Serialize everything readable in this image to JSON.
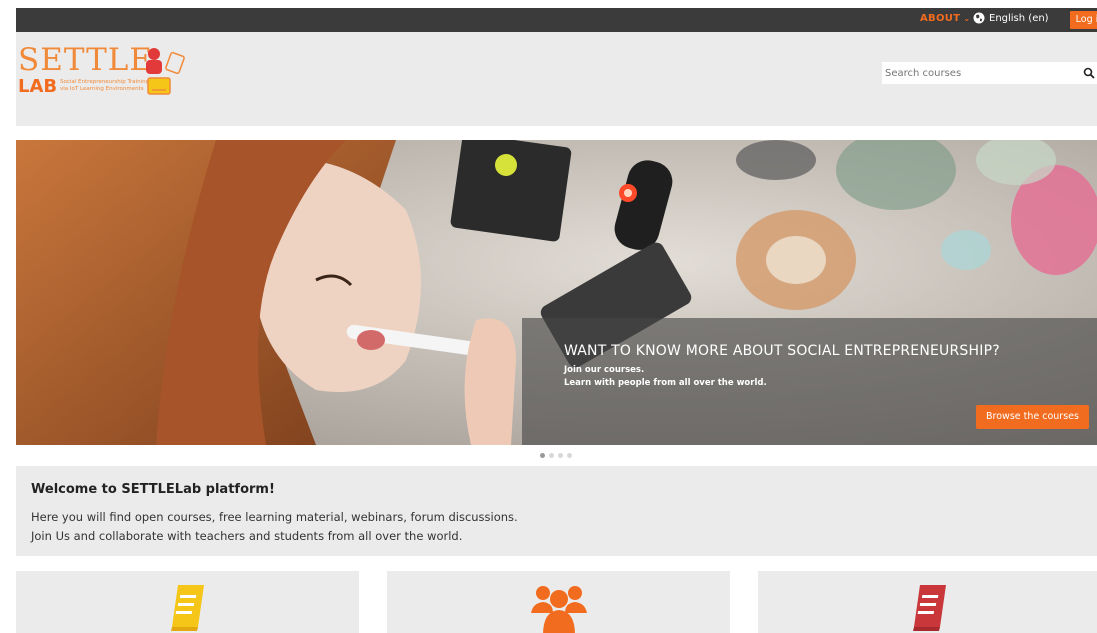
{
  "topbar": {
    "about_label": "ABOUT",
    "language_label": "English (en)",
    "login_label": "Log in"
  },
  "header": {
    "logo_title": "SETTLE",
    "logo_sub": "LAB",
    "logo_tagline_1": "Social Entrepreneurship Training",
    "logo_tagline_2": "via IoT Learning Environments",
    "search_placeholder": "Search courses"
  },
  "hero": {
    "heading": "WANT TO KNOW MORE ABOUT SOCIAL ENTREPRENEURSHIP?",
    "line1": "Join our courses.",
    "line2": "Learn with people from all over the world.",
    "button_label": "Browse the courses",
    "slide_count": 4,
    "active_slide": 1
  },
  "welcome": {
    "title": "Welcome to SETTLELab platform!",
    "line1": "Here you will find open courses, free learning material, webinars, forum discussions.",
    "line2": "Join Us and collaborate with teachers and students from all over the world."
  },
  "cards": [
    {
      "icon": "yellow-book-icon",
      "color": "#f5c518"
    },
    {
      "icon": "users-group-icon",
      "color": "#f26c1f"
    },
    {
      "icon": "red-book-icon",
      "color": "#c9373b"
    }
  ],
  "colors": {
    "accent": "#f26c1f",
    "topbar": "#3b3b3b",
    "panel": "#ebebeb"
  }
}
